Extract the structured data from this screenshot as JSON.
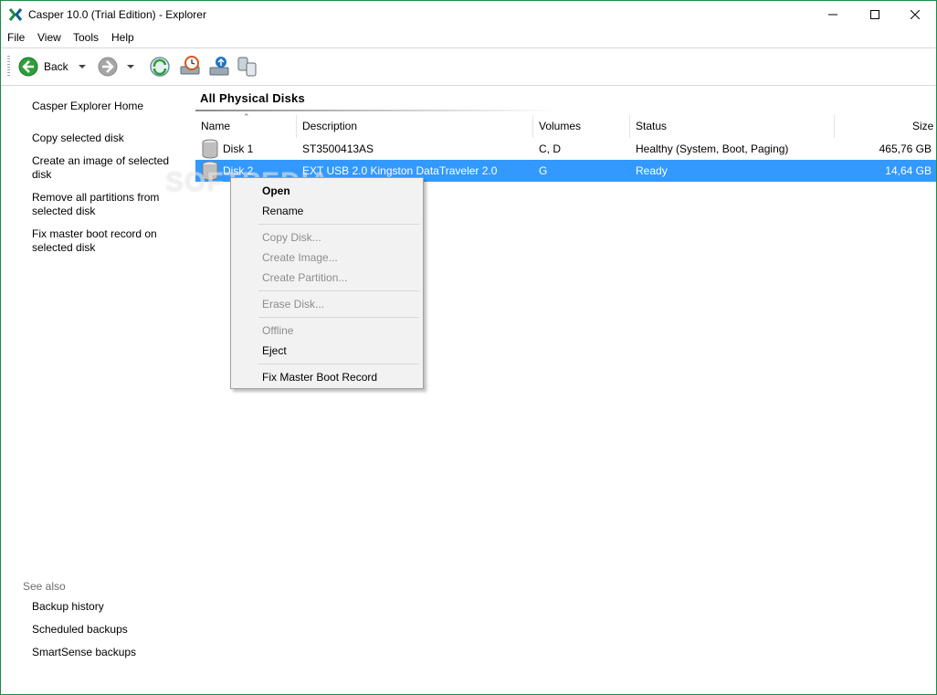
{
  "window": {
    "title": "Casper 10.0 (Trial Edition) - Explorer",
    "accent": "#1e8a46"
  },
  "menu": [
    "File",
    "View",
    "Tools",
    "Help"
  ],
  "toolbar": {
    "back_label": "Back",
    "icons": [
      "back-arrow-icon",
      "forward-arrow-icon",
      "refresh-disk-icon",
      "scheduled-backup-icon",
      "smartsense-icon",
      "copy-disk-icon"
    ]
  },
  "tasks": {
    "home": "Casper Explorer Home",
    "copy": "Copy selected disk",
    "image": "Create an image of selected disk",
    "remove": "Remove all partitions from selected disk",
    "fixmbr": "Fix master boot record on selected disk"
  },
  "see_also": {
    "title": "See also",
    "items": [
      "Backup history",
      "Scheduled backups",
      "SmartSense backups"
    ]
  },
  "main": {
    "title": "All Physical Disks",
    "columns": [
      "Name",
      "Description",
      "Volumes",
      "Status",
      "Size"
    ],
    "rows": [
      {
        "name": "Disk 1",
        "description": "ST3500413AS",
        "volumes": "C, D",
        "status": "Healthy (System, Boot, Paging)",
        "size": "465,76 GB"
      },
      {
        "name": "Disk 2",
        "description": "EXT USB 2.0 Kingston DataTraveler 2.0",
        "volumes": "G",
        "status": "Ready",
        "size": "14,64 GB"
      }
    ],
    "selection_color": "#3399ff"
  },
  "context_menu": {
    "open": "Open",
    "rename": "Rename",
    "copy_disk": "Copy Disk...",
    "create_image": "Create Image...",
    "create_partition": "Create Partition...",
    "erase_disk": "Erase Disk...",
    "offline": "Offline",
    "eject": "Eject",
    "fix_mbr": "Fix Master Boot Record"
  },
  "watermark": "SOFTPEDIA"
}
